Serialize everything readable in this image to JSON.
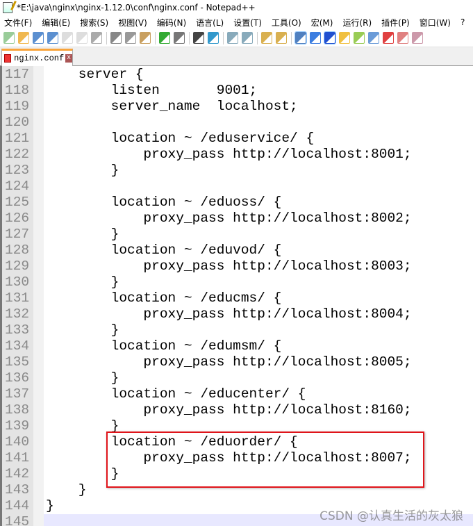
{
  "window": {
    "title": "*E:\\java\\nginx\\nginx-1.12.0\\conf\\nginx.conf - Notepad++"
  },
  "menu": [
    "文件(F)",
    "编辑(E)",
    "搜索(S)",
    "视图(V)",
    "编码(N)",
    "语言(L)",
    "设置(T)",
    "工具(O)",
    "宏(M)",
    "运行(R)",
    "插件(P)",
    "窗口(W)",
    "?"
  ],
  "toolbar": [
    {
      "icon": "new-file-icon",
      "color": "#9c9"
    },
    {
      "icon": "open-file-icon",
      "color": "#f0b850"
    },
    {
      "icon": "save-icon",
      "color": "#5b8fd0"
    },
    {
      "icon": "save-all-icon",
      "color": "#5b8fd0"
    },
    {
      "icon": "close-icon",
      "color": "#ddd"
    },
    {
      "icon": "close-all-icon",
      "color": "#ddd"
    },
    {
      "icon": "print-icon",
      "color": "#aaa"
    },
    "sep",
    {
      "icon": "cut-icon",
      "color": "#888"
    },
    {
      "icon": "copy-icon",
      "color": "#999"
    },
    {
      "icon": "paste-icon",
      "color": "#c9a060"
    },
    "sep",
    {
      "icon": "undo-icon",
      "color": "#3a3"
    },
    {
      "icon": "redo-icon",
      "color": "#777"
    },
    "sep",
    {
      "icon": "find-icon",
      "color": "#444"
    },
    {
      "icon": "replace-icon",
      "color": "#39c"
    },
    "sep",
    {
      "icon": "zoom-in-icon",
      "color": "#8ab"
    },
    {
      "icon": "zoom-out-icon",
      "color": "#8ab"
    },
    "sep",
    {
      "icon": "sync-vertical-icon",
      "color": "#d9b050"
    },
    {
      "icon": "sync-horizontal-icon",
      "color": "#d9b050"
    },
    "sep",
    {
      "icon": "word-wrap-icon",
      "color": "#5080c0",
      "active": true
    },
    {
      "icon": "show-all-chars-icon",
      "color": "#3b7de0"
    },
    {
      "icon": "indent-guide-icon",
      "color": "#2050d0",
      "active": true
    },
    {
      "icon": "udl-icon",
      "color": "#f0c040"
    },
    {
      "icon": "doc-map-icon",
      "color": "#9c5"
    },
    {
      "icon": "doc-list-icon",
      "color": "#6a9bd8"
    },
    {
      "icon": "function-list-icon",
      "color": "#e04040"
    },
    {
      "icon": "folder-workspace-icon",
      "color": "#e08080"
    },
    {
      "icon": "monitoring-icon",
      "color": "#c9a"
    }
  ],
  "tab": {
    "label": "nginx.conf",
    "close": "x"
  },
  "lines": [
    {
      "n": "117",
      "t": "    server {"
    },
    {
      "n": "118",
      "t": "        listen       9001;"
    },
    {
      "n": "119",
      "t": "        server_name  localhost;"
    },
    {
      "n": "120",
      "t": ""
    },
    {
      "n": "121",
      "t": "        location ~ /eduservice/ {"
    },
    {
      "n": "122",
      "t": "            proxy_pass http://localhost:8001;"
    },
    {
      "n": "123",
      "t": "        }"
    },
    {
      "n": "124",
      "t": ""
    },
    {
      "n": "125",
      "t": "        location ~ /eduoss/ {"
    },
    {
      "n": "126",
      "t": "            proxy_pass http://localhost:8002;"
    },
    {
      "n": "127",
      "t": "        }"
    },
    {
      "n": "128",
      "t": "        location ~ /eduvod/ {"
    },
    {
      "n": "129",
      "t": "            proxy_pass http://localhost:8003;"
    },
    {
      "n": "130",
      "t": "        }"
    },
    {
      "n": "131",
      "t": "        location ~ /educms/ {"
    },
    {
      "n": "132",
      "t": "            proxy_pass http://localhost:8004;"
    },
    {
      "n": "133",
      "t": "        }"
    },
    {
      "n": "134",
      "t": "        location ~ /edumsm/ {"
    },
    {
      "n": "135",
      "t": "            proxy_pass http://localhost:8005;"
    },
    {
      "n": "136",
      "t": "        }"
    },
    {
      "n": "137",
      "t": "        location ~ /educenter/ {"
    },
    {
      "n": "138",
      "t": "            proxy_pass http://localhost:8160;"
    },
    {
      "n": "139",
      "t": "        }"
    },
    {
      "n": "140",
      "t": "        location ~ /eduorder/ {"
    },
    {
      "n": "141",
      "t": "            proxy_pass http://localhost:8007;"
    },
    {
      "n": "142",
      "t": "        }"
    },
    {
      "n": "143",
      "t": "    }"
    },
    {
      "n": "144",
      "t": "}"
    },
    {
      "n": "145",
      "t": "",
      "current": true
    }
  ],
  "highlight_color": "#e0141a",
  "watermark": "CSDN @认真生活的灰太狼"
}
